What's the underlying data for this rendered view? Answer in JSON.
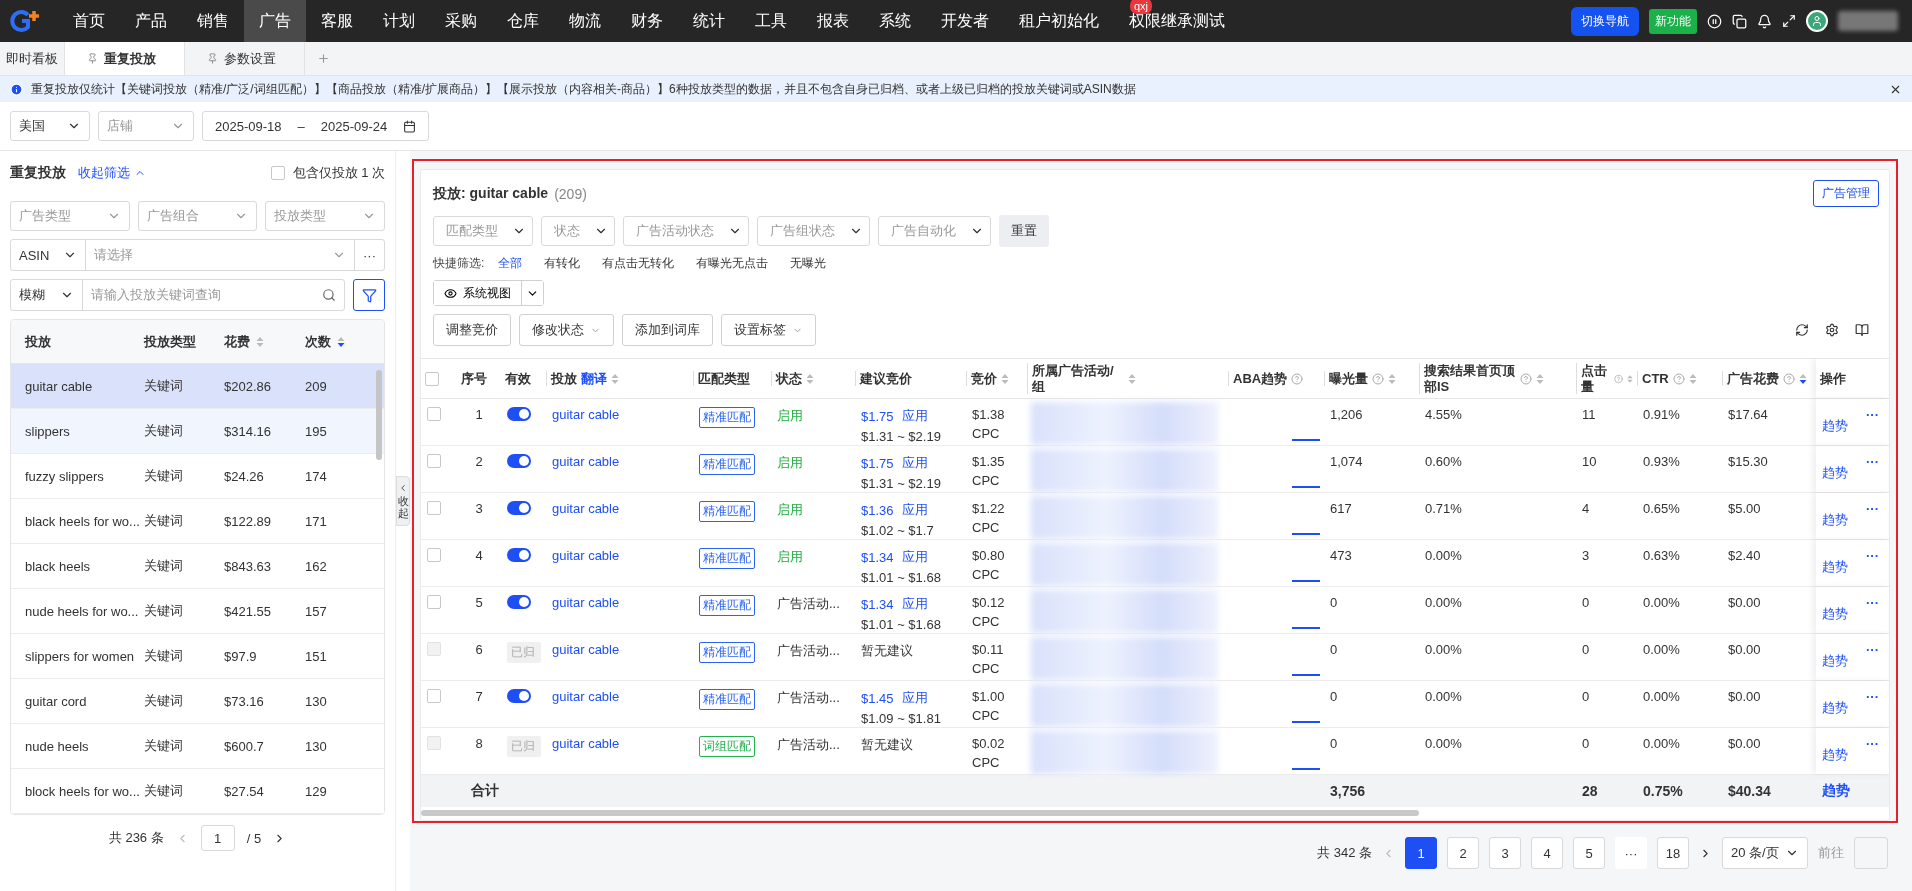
{
  "nav": {
    "items": [
      {
        "label": "首页",
        "selected": false
      },
      {
        "label": "产品",
        "selected": false
      },
      {
        "label": "销售",
        "selected": false
      },
      {
        "label": "广告",
        "selected": true
      },
      {
        "label": "客服",
        "selected": false
      },
      {
        "label": "计划",
        "selected": false
      },
      {
        "label": "采购",
        "selected": false
      },
      {
        "label": "仓库",
        "selected": false
      },
      {
        "label": "物流",
        "selected": false
      },
      {
        "label": "财务",
        "selected": false
      },
      {
        "label": "统计",
        "selected": false
      },
      {
        "label": "工具",
        "selected": false
      },
      {
        "label": "报表",
        "selected": false
      },
      {
        "label": "系统",
        "selected": false
      },
      {
        "label": "开发者",
        "selected": false
      },
      {
        "label": "租户初始化",
        "selected": false
      },
      {
        "label": "权限继承测试",
        "selected": false,
        "badge": "qxj"
      }
    ],
    "switch_button": "切换导航",
    "new_feature": "新功能"
  },
  "tabs": [
    {
      "label": "即时看板",
      "selected": false,
      "pinned": false
    },
    {
      "label": "重复投放",
      "selected": true,
      "pinned": true
    },
    {
      "label": "参数设置",
      "selected": false,
      "pinned": true
    }
  ],
  "notice": "重复投放仅统计【关键词投放（精准/广泛/词组匹配）】【商品投放（精准/扩展商品）】【展示投放（内容相关-商品）】6种投放类型的数据，并且不包含自身已归档、或者上级已归档的投放关键词或ASIN数据",
  "filters": {
    "country": "美国",
    "shop_placeholder": "店铺",
    "date_start": "2025-09-18",
    "date_separator": "–",
    "date_end": "2025-09-24"
  },
  "left": {
    "title": "重复投放",
    "collapse_link": "收起筛选",
    "include_once": {
      "label": "包含仅投放 1 次",
      "checked": false
    },
    "selects": [
      "广告类型",
      "广告组合",
      "投放类型"
    ],
    "asin_mode": "ASIN",
    "asin_placeholder": "请选择",
    "match_mode": "模糊",
    "search_placeholder": "请输入投放关键词查询",
    "asin_more": "···",
    "columns": [
      {
        "label": "投放"
      },
      {
        "label": "投放类型"
      },
      {
        "label": "花费",
        "sort_desc": false
      },
      {
        "label": "次数",
        "sort_desc": true
      }
    ],
    "rows": [
      {
        "target": "guitar cable",
        "type": "关键词",
        "spend": "$202.86",
        "count": "209",
        "selected": true,
        "hovered": false
      },
      {
        "target": "slippers",
        "type": "关键词",
        "spend": "$314.16",
        "count": "195",
        "selected": false,
        "hovered": true
      },
      {
        "target": "fuzzy slippers",
        "type": "关键词",
        "spend": "$24.26",
        "count": "174",
        "selected": false,
        "hovered": false
      },
      {
        "target": "black heels for wo...",
        "type": "关键词",
        "spend": "$122.89",
        "count": "171",
        "selected": false,
        "hovered": false
      },
      {
        "target": "black heels",
        "type": "关键词",
        "spend": "$843.63",
        "count": "162",
        "selected": false,
        "hovered": false
      },
      {
        "target": "nude heels for wo...",
        "type": "关键词",
        "spend": "$421.55",
        "count": "157",
        "selected": false,
        "hovered": false
      },
      {
        "target": "slippers for women",
        "type": "关键词",
        "spend": "$97.9",
        "count": "151",
        "selected": false,
        "hovered": false
      },
      {
        "target": "guitar cord",
        "type": "关键词",
        "spend": "$73.16",
        "count": "130",
        "selected": false,
        "hovered": false
      },
      {
        "target": "nude heels",
        "type": "关键词",
        "spend": "$600.7",
        "count": "130",
        "selected": false,
        "hovered": false
      },
      {
        "target": "block heels for wo...",
        "type": "关键词",
        "spend": "$27.54",
        "count": "129",
        "selected": false,
        "hovered": false
      }
    ],
    "pagination": {
      "total": "共 236 条",
      "page": "1",
      "pages": "/ 5"
    }
  },
  "collapse_handle": "收起",
  "panel": {
    "title": "投放: guitar cable",
    "count": "(209)",
    "manage_button": "广告管理",
    "selects": [
      "匹配类型",
      "状态",
      "广告活动状态",
      "广告组状态",
      "广告自动化"
    ],
    "reset": "重置",
    "quick_label": "快捷筛选:",
    "quick_filters": [
      {
        "label": "全部",
        "selected": true
      },
      {
        "label": "有转化",
        "selected": false
      },
      {
        "label": "有点击无转化",
        "selected": false
      },
      {
        "label": "有曝光无点击",
        "selected": false
      },
      {
        "label": "无曝光",
        "selected": false
      }
    ],
    "view_button": "系统视图",
    "actions": [
      {
        "label": "调整竞价",
        "menu": false
      },
      {
        "label": "修改状态",
        "menu": true
      },
      {
        "label": "添加到词库",
        "menu": false
      },
      {
        "label": "设置标签",
        "menu": true
      }
    ],
    "table": {
      "header_checked": false,
      "columns": [
        {
          "label": "序号"
        },
        {
          "label": "有效"
        },
        {
          "label": "投放",
          "link": "翻译",
          "sort_desc": false
        },
        {
          "label": "匹配类型"
        },
        {
          "label": "状态",
          "sort_desc": false
        },
        {
          "label": "建议竞价"
        },
        {
          "label": "竞价",
          "sort_desc": false
        },
        {
          "label": "所属广告活动/组",
          "sort_desc": false
        },
        {
          "label": "ABA趋势",
          "help": true
        },
        {
          "label": "曝光量",
          "help": true,
          "sort_desc": false
        },
        {
          "label": "搜索结果首页顶部IS",
          "help": true,
          "sort_desc": false
        },
        {
          "label": "点击量",
          "help": true,
          "sort_desc": false
        },
        {
          "label": "CTR",
          "help": true,
          "sort_desc": false
        },
        {
          "label": "广告花费",
          "help": true,
          "sort_desc": true
        },
        {
          "label": "操作"
        }
      ],
      "rows": [
        {
          "index": "1",
          "checked": false,
          "valid": {
            "kind": "toggle",
            "on": true
          },
          "target": "guitar cable",
          "match": {
            "kind": "exact",
            "label": "精准匹配"
          },
          "status": {
            "kind": "enabled",
            "label": "启用"
          },
          "suggest": {
            "kind": "bid",
            "bid": "$1.75",
            "apply": "应用",
            "range": "$1.31 ~ $2.19"
          },
          "bid": "$1.38",
          "unit": "CPC",
          "impressions": "1,206",
          "top_is": "4.55%",
          "clicks": "11",
          "ctr": "0.91%",
          "spend": "$17.64",
          "trend": "趋势",
          "more": "···"
        },
        {
          "index": "2",
          "checked": false,
          "valid": {
            "kind": "toggle",
            "on": true
          },
          "target": "guitar cable",
          "match": {
            "kind": "exact",
            "label": "精准匹配"
          },
          "status": {
            "kind": "enabled",
            "label": "启用"
          },
          "suggest": {
            "kind": "bid",
            "bid": "$1.75",
            "apply": "应用",
            "range": "$1.31 ~ $2.19"
          },
          "bid": "$1.35",
          "unit": "CPC",
          "impressions": "1,074",
          "top_is": "0.60%",
          "clicks": "10",
          "ctr": "0.93%",
          "spend": "$15.30",
          "trend": "趋势",
          "more": "···"
        },
        {
          "index": "3",
          "checked": false,
          "valid": {
            "kind": "toggle",
            "on": true
          },
          "target": "guitar cable",
          "match": {
            "kind": "exact",
            "label": "精准匹配"
          },
          "status": {
            "kind": "enabled",
            "label": "启用"
          },
          "suggest": {
            "kind": "bid",
            "bid": "$1.36",
            "apply": "应用",
            "range": "$1.02 ~ $1.7"
          },
          "bid": "$1.22",
          "unit": "CPC",
          "impressions": "617",
          "top_is": "0.71%",
          "clicks": "4",
          "ctr": "0.65%",
          "spend": "$5.00",
          "trend": "趋势",
          "more": "···"
        },
        {
          "index": "4",
          "checked": false,
          "valid": {
            "kind": "toggle",
            "on": true
          },
          "target": "guitar cable",
          "match": {
            "kind": "exact",
            "label": "精准匹配"
          },
          "status": {
            "kind": "enabled",
            "label": "启用"
          },
          "suggest": {
            "kind": "bid",
            "bid": "$1.34",
            "apply": "应用",
            "range": "$1.01 ~ $1.68"
          },
          "bid": "$0.80",
          "unit": "CPC",
          "impressions": "473",
          "top_is": "0.00%",
          "clicks": "3",
          "ctr": "0.63%",
          "spend": "$2.40",
          "trend": "趋势",
          "more": "···"
        },
        {
          "index": "5",
          "checked": false,
          "valid": {
            "kind": "toggle",
            "on": true
          },
          "target": "guitar cable",
          "match": {
            "kind": "exact",
            "label": "精准匹配"
          },
          "status": {
            "kind": "other",
            "label": "广告活动..."
          },
          "suggest": {
            "kind": "bid",
            "bid": "$1.34",
            "apply": "应用",
            "range": "$1.01 ~ $1.68"
          },
          "bid": "$0.12",
          "unit": "CPC",
          "impressions": "0",
          "top_is": "0.00%",
          "clicks": "0",
          "ctr": "0.00%",
          "spend": "$0.00",
          "trend": "趋势",
          "more": "···"
        },
        {
          "index": "6",
          "checked": false,
          "valid": {
            "kind": "archived",
            "label": "已归"
          },
          "target": "guitar cable",
          "match": {
            "kind": "exact",
            "label": "精准匹配"
          },
          "status": {
            "kind": "other",
            "label": "广告活动..."
          },
          "suggest": {
            "kind": "none",
            "label": "暂无建议"
          },
          "bid": "$0.11",
          "unit": "CPC",
          "impressions": "0",
          "top_is": "0.00%",
          "clicks": "0",
          "ctr": "0.00%",
          "spend": "$0.00",
          "trend": "趋势",
          "more": "···"
        },
        {
          "index": "7",
          "checked": false,
          "valid": {
            "kind": "toggle",
            "on": true
          },
          "target": "guitar cable",
          "match": {
            "kind": "exact",
            "label": "精准匹配"
          },
          "status": {
            "kind": "other",
            "label": "广告活动..."
          },
          "suggest": {
            "kind": "bid",
            "bid": "$1.45",
            "apply": "应用",
            "range": "$1.09 ~ $1.81"
          },
          "bid": "$1.00",
          "unit": "CPC",
          "impressions": "0",
          "top_is": "0.00%",
          "clicks": "0",
          "ctr": "0.00%",
          "spend": "$0.00",
          "trend": "趋势",
          "more": "···"
        },
        {
          "index": "8",
          "checked": false,
          "valid": {
            "kind": "archived",
            "label": "已归"
          },
          "target": "guitar cable",
          "match": {
            "kind": "phrase",
            "label": "词组匹配"
          },
          "status": {
            "kind": "other",
            "label": "广告活动..."
          },
          "suggest": {
            "kind": "none",
            "label": "暂无建议"
          },
          "bid": "$0.02",
          "unit": "CPC",
          "impressions": "0",
          "top_is": "0.00%",
          "clicks": "0",
          "ctr": "0.00%",
          "spend": "$0.00",
          "trend": "趋势",
          "more": "···"
        }
      ],
      "totals": {
        "label": "合计",
        "impressions": "3,756",
        "clicks": "28",
        "ctr": "0.75%",
        "spend": "$40.34",
        "trend": "趋势"
      }
    },
    "pagination": {
      "total": "共 342 条",
      "pages": [
        {
          "label": "1",
          "selected": true
        },
        {
          "label": "2",
          "selected": false
        },
        {
          "label": "3",
          "selected": false
        },
        {
          "label": "4",
          "selected": false
        },
        {
          "label": "5",
          "selected": false
        },
        {
          "label": "···",
          "selected": false,
          "kind": "ellipsis"
        },
        {
          "label": "18",
          "selected": false
        }
      ],
      "page_size": "20 条/页",
      "goto": "前往"
    }
  }
}
